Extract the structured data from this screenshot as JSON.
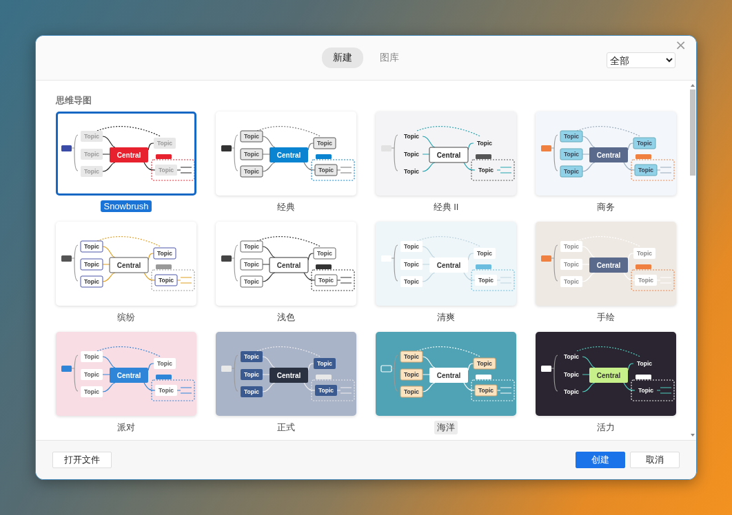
{
  "header": {
    "tabs": [
      {
        "label": "新建",
        "selected": true
      },
      {
        "label": "图库",
        "selected": false
      }
    ],
    "filter": {
      "value": "全部"
    },
    "close": "×"
  },
  "section": {
    "title": "思维导图"
  },
  "templates": [
    {
      "name": "Snowbrush",
      "selected": true,
      "hovered": false,
      "central": "Central",
      "topics": [
        "Topic",
        "Topic",
        "Topic",
        "Topic",
        "Topic"
      ]
    },
    {
      "name": "经典",
      "selected": false,
      "hovered": false,
      "central": "Central",
      "topics": [
        "Topic",
        "Topic",
        "Topic",
        "Topic",
        "Topic"
      ]
    },
    {
      "name": "经典 II",
      "selected": false,
      "hovered": false,
      "central": "Central",
      "topics": [
        "Topic",
        "Topic",
        "Topic",
        "Topic",
        "Topic"
      ]
    },
    {
      "name": "商务",
      "selected": false,
      "hovered": false,
      "central": "Central",
      "topics": [
        "Topic",
        "Topic",
        "Topic",
        "Topic",
        "Topic"
      ]
    },
    {
      "name": "缤纷",
      "selected": false,
      "hovered": false,
      "central": "Central",
      "topics": [
        "Topic",
        "Topic",
        "Topic",
        "Topic",
        "Topic"
      ]
    },
    {
      "name": "浅色",
      "selected": false,
      "hovered": false,
      "central": "Central",
      "topics": [
        "Topic",
        "Topic",
        "Topic",
        "Topic",
        "Topic"
      ]
    },
    {
      "name": "清爽",
      "selected": false,
      "hovered": false,
      "central": "Central",
      "topics": [
        "Topic",
        "Topic",
        "Topic",
        "Topic",
        "Topic"
      ]
    },
    {
      "name": "手绘",
      "selected": false,
      "hovered": false,
      "central": "Central",
      "topics": [
        "Topic",
        "Topic",
        "Topic",
        "Topic",
        "Topic"
      ]
    },
    {
      "name": "派对",
      "selected": false,
      "hovered": false,
      "central": "Central",
      "topics": [
        "Topic",
        "Topic",
        "Topic",
        "Topic",
        "Topic"
      ]
    },
    {
      "name": "正式",
      "selected": false,
      "hovered": false,
      "central": "Central",
      "topics": [
        "Topic",
        "Topic",
        "Topic",
        "Topic",
        "Topic"
      ]
    },
    {
      "name": "海洋",
      "selected": false,
      "hovered": true,
      "central": "Central",
      "topics": [
        "Topic",
        "Topic",
        "Topic",
        "Topic",
        "Topic"
      ]
    },
    {
      "name": "活力",
      "selected": false,
      "hovered": false,
      "central": "Central",
      "topics": [
        "Topic",
        "Topic",
        "Topic",
        "Topic",
        "Topic"
      ]
    }
  ],
  "footer": {
    "open_file": "打开文件",
    "buttons": [
      {
        "label": "创建",
        "kind": "primary"
      },
      {
        "label": "取消",
        "kind": "secondary"
      }
    ]
  }
}
